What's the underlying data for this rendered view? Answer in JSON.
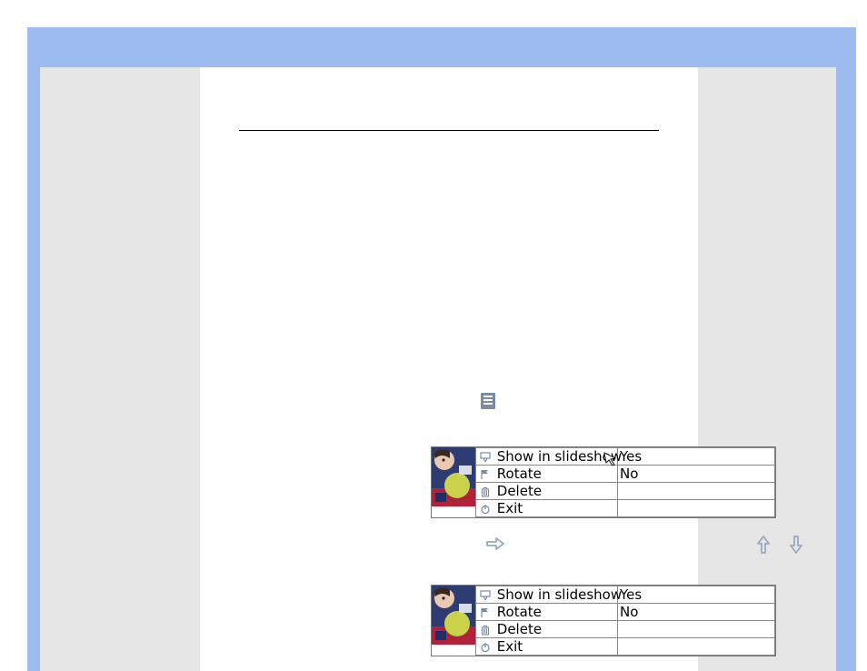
{
  "colors": {
    "frame_blue": "#9cbcf0",
    "paper_gray": "#e6e6e6",
    "icon_gray": "#7a8ba5",
    "arrow_gray": "#9aa8c2"
  },
  "menu1": {
    "selected_index": 0,
    "items": [
      {
        "label": "Show in slideshow",
        "value": "Yes",
        "icon": "projector-icon"
      },
      {
        "label": "Rotate",
        "value": "No",
        "icon": "flag-icon"
      },
      {
        "label": "Delete",
        "value": "",
        "icon": "trash-icon"
      },
      {
        "label": "Exit",
        "value": "",
        "icon": "power-icon"
      }
    ]
  },
  "menu2": {
    "selected_index": 0,
    "items": [
      {
        "label": "Show in slideshow",
        "value": "Yes",
        "icon": "projector-icon"
      },
      {
        "label": "Rotate",
        "value": "No",
        "icon": "flag-icon"
      },
      {
        "label": "Delete",
        "value": "",
        "icon": "trash-icon"
      },
      {
        "label": "Exit",
        "value": "",
        "icon": "power-icon"
      }
    ]
  }
}
